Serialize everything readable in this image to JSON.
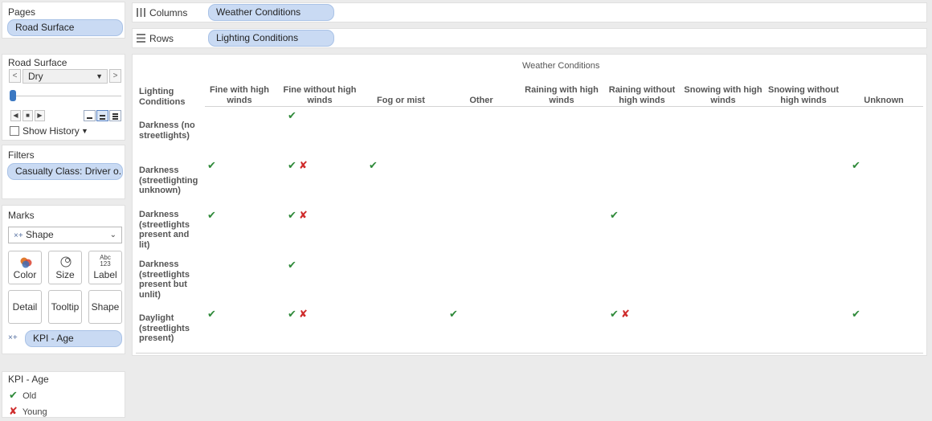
{
  "pages": {
    "title": "Pages",
    "pill": "Road Surface"
  },
  "road_surface": {
    "title": "Road Surface",
    "value": "Dry",
    "prev": "<",
    "next": ">",
    "show_history": "Show History"
  },
  "filters": {
    "title": "Filters",
    "pill": "Casualty Class: Driver o.."
  },
  "marks": {
    "title": "Marks",
    "type": "Shape",
    "buttons": {
      "color": "Color",
      "size": "Size",
      "label": "Label",
      "detail": "Detail",
      "tooltip": "Tooltip",
      "shape": "Shape"
    },
    "label_icon_text": "Abc\n123",
    "field_pill": "KPI - Age"
  },
  "legend": {
    "title": "KPI - Age",
    "items": [
      {
        "symbol": "✔",
        "label": "Old",
        "color": "#2f8a3a"
      },
      {
        "symbol": "✘",
        "label": "Young",
        "color": "#cf2b2b"
      }
    ]
  },
  "shelves": {
    "columns_label": "Columns",
    "columns_pill": "Weather Conditions",
    "rows_label": "Rows",
    "rows_pill": "Lighting Conditions"
  },
  "view": {
    "column_title": "Weather Conditions",
    "row_header_title": "Lighting Conditions",
    "columns": [
      "Fine with high winds",
      "Fine without high winds",
      "Fog or mist",
      "Other",
      "Raining with high winds",
      "Raining without high winds",
      "Snowing with high winds",
      "Snowing without high winds",
      "Unknown"
    ],
    "rows": [
      {
        "label": "Darkness (no streetlights)",
        "cells": [
          [],
          [
            "Old"
          ],
          [],
          [],
          [],
          [],
          [],
          [],
          []
        ]
      },
      {
        "label": "Darkness (streetlighting unknown)",
        "cells": [
          [
            "Old"
          ],
          [
            "Old",
            "Young"
          ],
          [
            "Old"
          ],
          [],
          [],
          [],
          [],
          [],
          [
            "Old"
          ]
        ]
      },
      {
        "label": "Darkness (streetlights present and lit)",
        "cells": [
          [
            "Old"
          ],
          [
            "Old",
            "Young"
          ],
          [],
          [],
          [],
          [
            "Old"
          ],
          [],
          [],
          []
        ]
      },
      {
        "label": "Darkness (streetlights present but unlit)",
        "cells": [
          [],
          [
            "Old"
          ],
          [],
          [],
          [],
          [],
          [],
          [],
          []
        ]
      },
      {
        "label": "Daylight (streetlights present)",
        "cells": [
          [
            "Old"
          ],
          [
            "Old",
            "Young"
          ],
          [],
          [
            "Old"
          ],
          [],
          [
            "Old",
            "Young"
          ],
          [],
          [],
          [
            "Old"
          ]
        ]
      }
    ],
    "symbols": {
      "Old": "✔",
      "Young": "✘"
    },
    "colors": {
      "Old": "#2f8a3a",
      "Young": "#cf2b2b"
    }
  }
}
